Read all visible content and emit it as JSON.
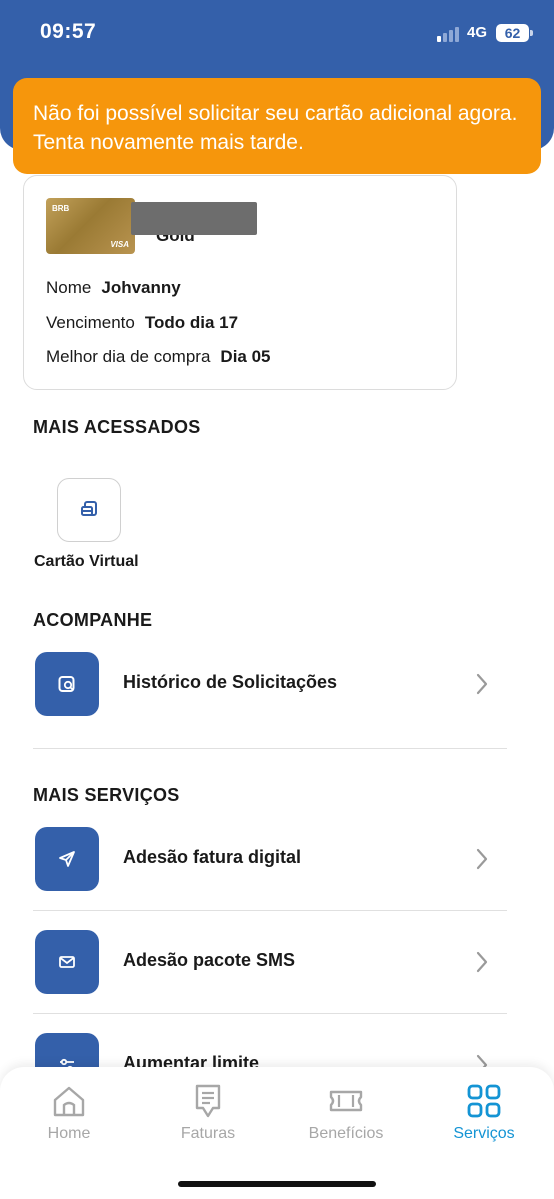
{
  "status_bar": {
    "time": "09:57",
    "network": "4G",
    "battery": "62"
  },
  "toast": {
    "message": "Não foi possível solicitar seu cartão adicional agora. Tenta novamente mais tarde."
  },
  "card": {
    "brand": "BRB",
    "network_logo": "VISA",
    "name": "Gold",
    "fields": [
      {
        "label": "Nome",
        "value": "Johvanny"
      },
      {
        "label": "Vencimento",
        "value": "Todo dia 17"
      },
      {
        "label": "Melhor dia de compra",
        "value": "Dia 05"
      }
    ]
  },
  "most_accessed": {
    "title": "MAIS ACESSADOS",
    "items": [
      {
        "label": "Cartão Virtual",
        "icon": "virtual-card-icon"
      }
    ]
  },
  "follow_up": {
    "title": "ACOMPANHE",
    "items": [
      {
        "label": "Histórico de Solicitações",
        "icon": "request-history-icon"
      }
    ]
  },
  "more_services": {
    "title": "MAIS SERVIÇOS",
    "items": [
      {
        "label": "Adesão fatura digital",
        "icon": "paper-plane-icon"
      },
      {
        "label": "Adesão pacote SMS",
        "icon": "envelope-icon"
      },
      {
        "label": "Aumentar limite",
        "icon": "sliders-icon"
      }
    ]
  },
  "tab_bar": {
    "tabs": [
      {
        "label": "Home",
        "icon": "home-icon",
        "active": false
      },
      {
        "label": "Faturas",
        "icon": "invoice-icon",
        "active": false
      },
      {
        "label": "Benefícios",
        "icon": "ticket-icon",
        "active": false
      },
      {
        "label": "Serviços",
        "icon": "grid-icon",
        "active": true
      }
    ]
  },
  "colors": {
    "header": "#3460aa",
    "toast": "#f6960c",
    "accent": "#1494d4",
    "icon_tile": "#3460aa"
  }
}
